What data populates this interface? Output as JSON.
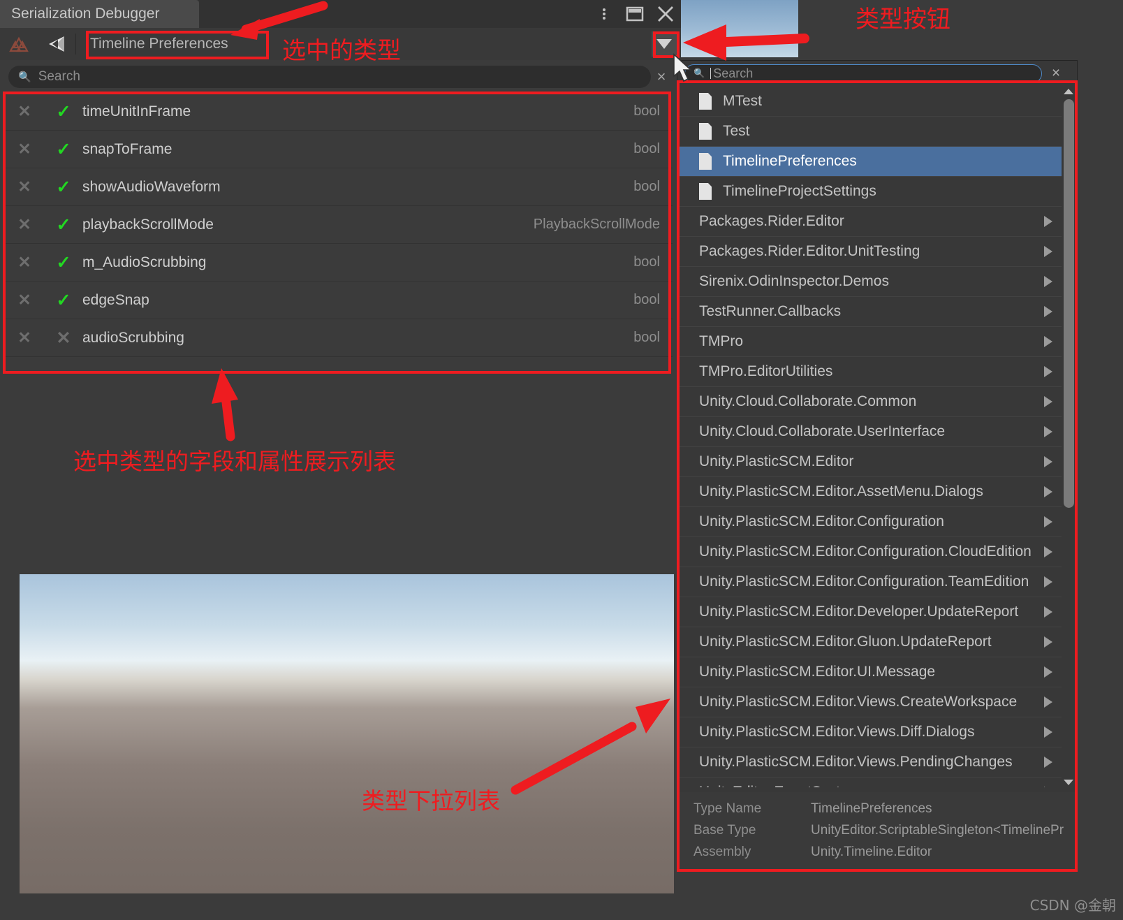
{
  "window": {
    "tab_title": "Serialization Debugger",
    "buttons": {
      "kebab": "more-options",
      "maximize": "maximize",
      "close": "close"
    }
  },
  "toolbar": {
    "icon_left": "valknut-icon",
    "icon_unity": "unity-icon",
    "selected_type": "Timeline Preferences",
    "dropdown_label": "▼"
  },
  "search": {
    "placeholder": "Search",
    "value": "",
    "clear_label": "×",
    "glyph": "search-icon"
  },
  "properties": {
    "columns": [
      "remove",
      "enabled",
      "name",
      "type"
    ],
    "rows": [
      {
        "remove": "✕",
        "enabled": true,
        "name": "timeUnitInFrame",
        "type": "bool"
      },
      {
        "remove": "✕",
        "enabled": true,
        "name": "snapToFrame",
        "type": "bool"
      },
      {
        "remove": "✕",
        "enabled": true,
        "name": "showAudioWaveform",
        "type": "bool"
      },
      {
        "remove": "✕",
        "enabled": true,
        "name": "playbackScrollMode",
        "type": "PlaybackScrollMode"
      },
      {
        "remove": "✕",
        "enabled": true,
        "name": "m_AudioScrubbing",
        "type": "bool"
      },
      {
        "remove": "✕",
        "enabled": true,
        "name": "edgeSnap",
        "type": "bool"
      },
      {
        "remove": "✕",
        "enabled": false,
        "name": "audioScrubbing",
        "type": "bool"
      }
    ],
    "check_on": "✓",
    "check_off": "✕"
  },
  "popup": {
    "search": {
      "placeholder": "Search",
      "value": "",
      "clear_label": "×"
    },
    "items": [
      {
        "label": "MTest",
        "kind": "leaf",
        "selected": false
      },
      {
        "label": "Test",
        "kind": "leaf",
        "selected": false
      },
      {
        "label": "TimelinePreferences",
        "kind": "leaf",
        "selected": true
      },
      {
        "label": "TimelineProjectSettings",
        "kind": "leaf",
        "selected": false
      },
      {
        "label": "Packages.Rider.Editor",
        "kind": "submenu",
        "selected": false
      },
      {
        "label": "Packages.Rider.Editor.UnitTesting",
        "kind": "submenu",
        "selected": false
      },
      {
        "label": "Sirenix.OdinInspector.Demos",
        "kind": "submenu",
        "selected": false
      },
      {
        "label": "TestRunner.Callbacks",
        "kind": "submenu",
        "selected": false
      },
      {
        "label": "TMPro",
        "kind": "submenu",
        "selected": false
      },
      {
        "label": "TMPro.EditorUtilities",
        "kind": "submenu",
        "selected": false
      },
      {
        "label": "Unity.Cloud.Collaborate.Common",
        "kind": "submenu",
        "selected": false
      },
      {
        "label": "Unity.Cloud.Collaborate.UserInterface",
        "kind": "submenu",
        "selected": false
      },
      {
        "label": "Unity.PlasticSCM.Editor",
        "kind": "submenu",
        "selected": false
      },
      {
        "label": "Unity.PlasticSCM.Editor.AssetMenu.Dialogs",
        "kind": "submenu",
        "selected": false
      },
      {
        "label": "Unity.PlasticSCM.Editor.Configuration",
        "kind": "submenu",
        "selected": false
      },
      {
        "label": "Unity.PlasticSCM.Editor.Configuration.CloudEdition",
        "kind": "submenu",
        "selected": false
      },
      {
        "label": "Unity.PlasticSCM.Editor.Configuration.TeamEdition",
        "kind": "submenu",
        "selected": false
      },
      {
        "label": "Unity.PlasticSCM.Editor.Developer.UpdateReport",
        "kind": "submenu",
        "selected": false
      },
      {
        "label": "Unity.PlasticSCM.Editor.Gluon.UpdateReport",
        "kind": "submenu",
        "selected": false
      },
      {
        "label": "Unity.PlasticSCM.Editor.UI.Message",
        "kind": "submenu",
        "selected": false
      },
      {
        "label": "Unity.PlasticSCM.Editor.Views.CreateWorkspace",
        "kind": "submenu",
        "selected": false
      },
      {
        "label": "Unity.PlasticSCM.Editor.Views.Diff.Dialogs",
        "kind": "submenu",
        "selected": false
      },
      {
        "label": "Unity.PlasticSCM.Editor.Views.PendingChanges",
        "kind": "submenu",
        "selected": false
      },
      {
        "label": "UnityEditor.EventSystems",
        "kind": "submenu",
        "selected": false
      }
    ],
    "info": [
      {
        "key": "Type Name",
        "value": "TimelinePreferences"
      },
      {
        "key": "Base Type",
        "value": "UnityEditor.ScriptableSingleton<TimelinePr"
      },
      {
        "key": "Assembly",
        "value": "Unity.Timeline.Editor"
      }
    ]
  },
  "annotations": {
    "selected_type_label": "选中的类型",
    "type_button_label": "类型按钮",
    "field_list_label": "选中类型的字段和属性展示列表",
    "type_dropdown_label": "类型下拉列表",
    "color": "#ee1c20"
  },
  "watermark": {
    "text": "CSDN @金朝"
  }
}
